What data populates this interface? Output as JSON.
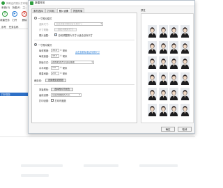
{
  "app": {
    "title": "神奇证件照片打印软件",
    "menu": [
      "系统(S)",
      "功能(F)",
      "工..."
    ],
    "toolbar": [
      {
        "label": "新建任务",
        "icon": "plus-icon"
      },
      {
        "label": "打开",
        "icon": "folder-icon"
      },
      {
        "label": "删除",
        "icon": "delete-icon"
      }
    ],
    "list_headers": [
      "序号",
      "任务名称"
    ],
    "sidebar_selected": "打印任务"
  },
  "dialog": {
    "title": "新建任务",
    "tabs": [
      "素材选择",
      "打印机",
      "照片设置",
      "拼图布局"
    ],
    "active_tab": 2,
    "single_mode_label": "一寸照片模式",
    "select_size_label": "选择尺寸：",
    "select_size_value": "请选择要排版的证件照尺寸",
    "size_label": "尺寸规格：",
    "custom_size_button": "自定义照片尺寸",
    "auto_fit_label": "照片适配：",
    "auto_fit_option": "自动调整照片尺寸以适合目标尺寸",
    "multi_mode_label": "一寸照片模式",
    "width_label": "每张宽度：",
    "width_value": "35.0",
    "width_unit": "毫米",
    "height_label": "每张高度：",
    "height_value": "49.0",
    "height_unit": "毫米",
    "size_help_link": "点击查看标准证件照尺寸",
    "layout_label": "排版方式：",
    "layout_value": "按照纸张大小自动排版",
    "h_spacing_label": "水平间距：",
    "h_spacing_value": "2.0",
    "h_spacing_unit": "毫米",
    "v_spacing_label": "垂直间距：",
    "v_spacing_value": "2.0",
    "v_spacing_unit": "毫米",
    "cut_line_label": "裁剪线：",
    "cut_line_button": "设置裁剪线参数",
    "bg_color_label": "背景颜色：",
    "bg_color_button": "选择照片背景色",
    "border_label": "画线设置：",
    "border_value": "请选择画线的方式",
    "print_label": "打印设置：",
    "print_option": "打印时缩放",
    "preview_label": "预览",
    "ok_button": "确定",
    "cancel_button": "取消"
  }
}
